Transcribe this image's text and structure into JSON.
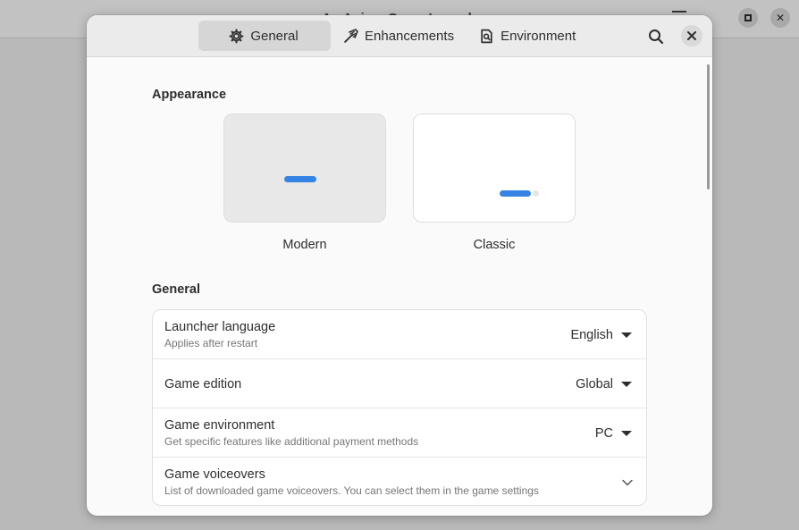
{
  "background_window": {
    "title": "An Anime Game Launcher"
  },
  "dialog": {
    "tabs": [
      {
        "label": "General",
        "icon": "gear-icon",
        "active": true
      },
      {
        "label": "Enhancements",
        "icon": "magic-wand-icon",
        "active": false
      },
      {
        "label": "Environment",
        "icon": "document-search-icon",
        "active": false
      }
    ],
    "search_icon": "search-icon",
    "close_icon": "close-icon"
  },
  "appearance": {
    "title": "Appearance",
    "themes": [
      {
        "label": "Modern",
        "selected": true
      },
      {
        "label": "Classic",
        "selected": false
      }
    ],
    "accent": "#3584e4"
  },
  "general": {
    "title": "General",
    "rows": [
      {
        "title": "Launcher language",
        "subtitle": "Applies after restart",
        "value": "English",
        "control": "dropdown"
      },
      {
        "title": "Game edition",
        "subtitle": "",
        "value": "Global",
        "control": "dropdown"
      },
      {
        "title": "Game environment",
        "subtitle": "Get specific features like additional payment methods",
        "value": "PC",
        "control": "dropdown"
      },
      {
        "title": "Game voiceovers",
        "subtitle": "List of downloaded game voiceovers. You can select them in the game settings",
        "value": "",
        "control": "expander"
      }
    ]
  }
}
